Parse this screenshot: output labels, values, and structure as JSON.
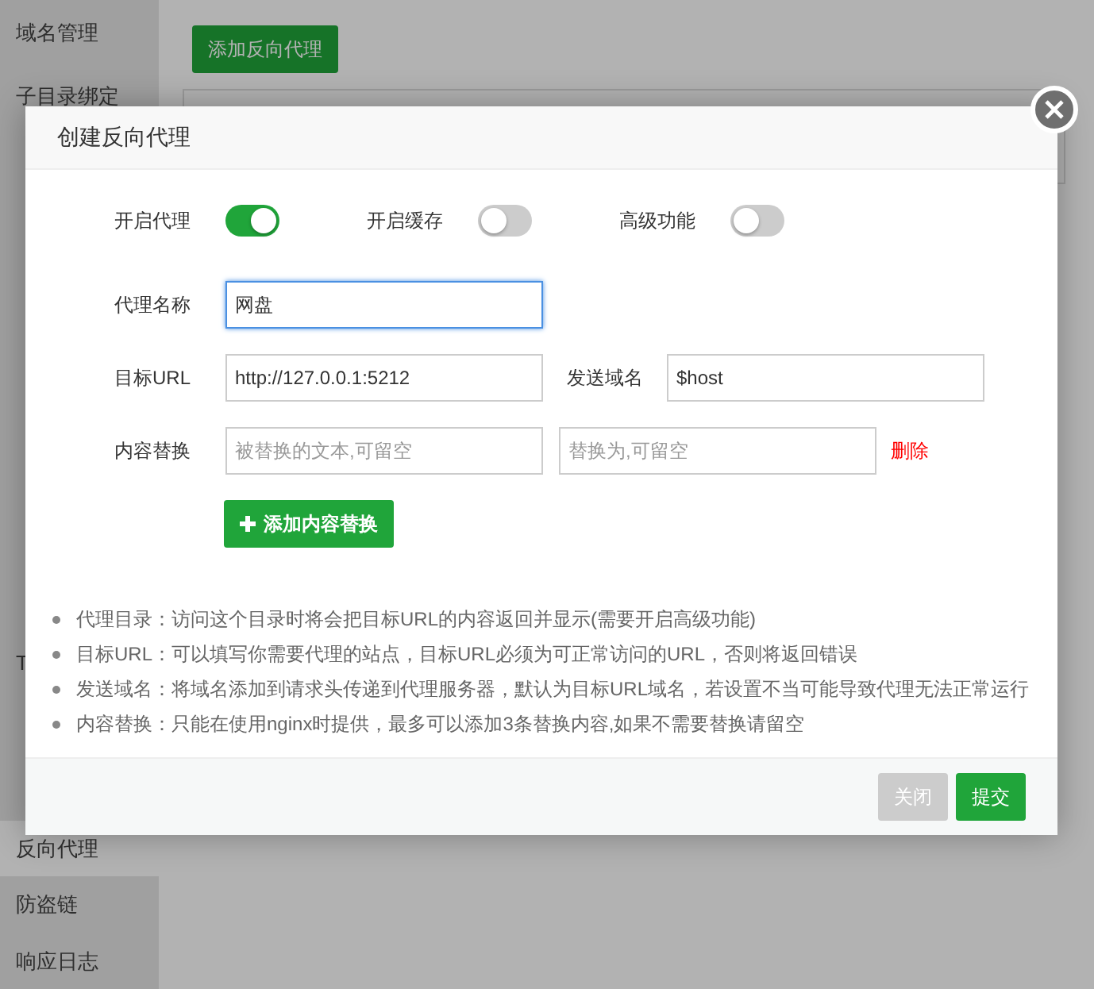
{
  "sidebar": {
    "groups": [
      {
        "items": [
          {
            "label": "域名管理",
            "selected": false
          },
          {
            "label": "子目录绑定",
            "selected": false
          }
        ]
      },
      {
        "items": [
          {
            "label": "T",
            "selected": false
          }
        ]
      },
      {
        "items": [
          {
            "label": "反向代理",
            "selected": true
          },
          {
            "label": "防盗链",
            "selected": false
          },
          {
            "label": "响应日志",
            "selected": false
          }
        ]
      }
    ]
  },
  "toolbar": {
    "add_button": "添加反向代理"
  },
  "dialog": {
    "title": "创建反向代理",
    "toggles": [
      {
        "label": "开启代理",
        "on": true
      },
      {
        "label": "开启缓存",
        "on": false
      },
      {
        "label": "高级功能",
        "on": false
      }
    ],
    "name_field": {
      "label": "代理名称",
      "value": "网盘",
      "focused": true
    },
    "target_row": {
      "label": "目标URL",
      "value": "http://127.0.0.1:5212",
      "focused": false,
      "send_label": "发送域名",
      "send_value": "$host"
    },
    "replace_row": {
      "label": "内容替换",
      "from_placeholder": "被替换的文本,可留空",
      "to_placeholder": "替换为,可留空",
      "delete_link": "删除"
    },
    "add_replace_button": "添加内容替换",
    "notes": [
      "代理目录：访问这个目录时将会把目标URL的内容返回并显示(需要开启高级功能)",
      "目标URL：可以填写你需要代理的站点，目标URL必须为可正常访问的URL，否则将返回错误",
      "发送域名：将域名添加到请求头传递到代理服务器，默认为目标URL域名，若设置不当可能导致代理无法正常运行",
      "内容替换：只能在使用nginx时提供，最多可以添加3条替换内容,如果不需要替换请留空"
    ],
    "buttons": [
      {
        "label": "关闭",
        "kind": "secondary"
      },
      {
        "label": "提交",
        "kind": "primary"
      }
    ]
  }
}
